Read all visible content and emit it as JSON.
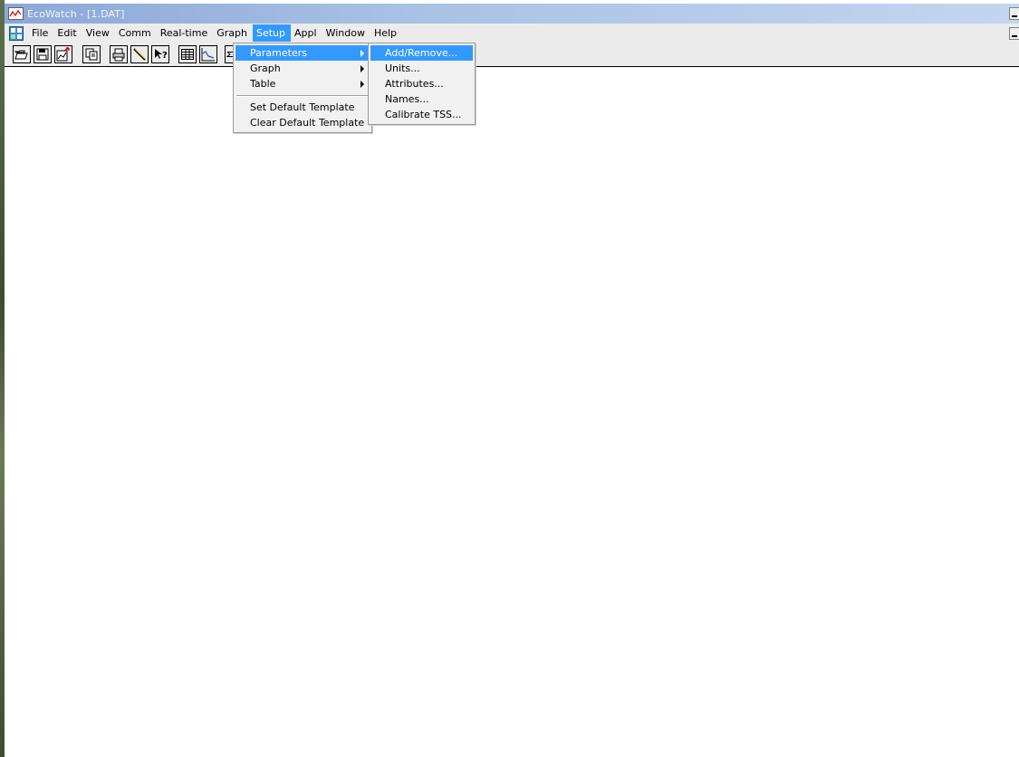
{
  "window": {
    "title": "EcoWatch - [1.DAT]",
    "app_icon": "ecowatch-chart-icon"
  },
  "menubar": {
    "doc_icon": "document-icon",
    "items": [
      "File",
      "Edit",
      "View",
      "Comm",
      "Real-time",
      "Graph",
      "Setup",
      "Appl",
      "Window",
      "Help"
    ],
    "active": "Setup"
  },
  "toolbar": {
    "icons": [
      "open-folder-icon",
      "save-icon",
      "export-chart-icon",
      "copy-icon",
      "print-icon",
      "probe-icon",
      "context-help-icon",
      "table-icon",
      "graph-icon",
      "sigma-icon"
    ]
  },
  "setup_menu": {
    "items": [
      {
        "label": "Parameters",
        "submenu": true,
        "highlighted": true
      },
      {
        "label": "Graph",
        "submenu": true,
        "highlighted": false
      },
      {
        "label": "Table",
        "submenu": true,
        "highlighted": false
      },
      {
        "label": "Set Default Template",
        "submenu": false,
        "highlighted": false
      },
      {
        "label": "Clear Default Template",
        "submenu": false,
        "highlighted": false
      }
    ]
  },
  "parameters_submenu": {
    "items": [
      {
        "label": "Add/Remove...",
        "highlighted": true
      },
      {
        "label": "Units...",
        "highlighted": false
      },
      {
        "label": "Attributes...",
        "highlighted": false
      },
      {
        "label": "Names...",
        "highlighted": false
      },
      {
        "label": "Calibrate TSS...",
        "highlighted": false
      }
    ]
  },
  "colors": {
    "highlight": "#3399ff",
    "title_bar": "#a9c1e4",
    "menu_background": "#f1f1f1"
  }
}
